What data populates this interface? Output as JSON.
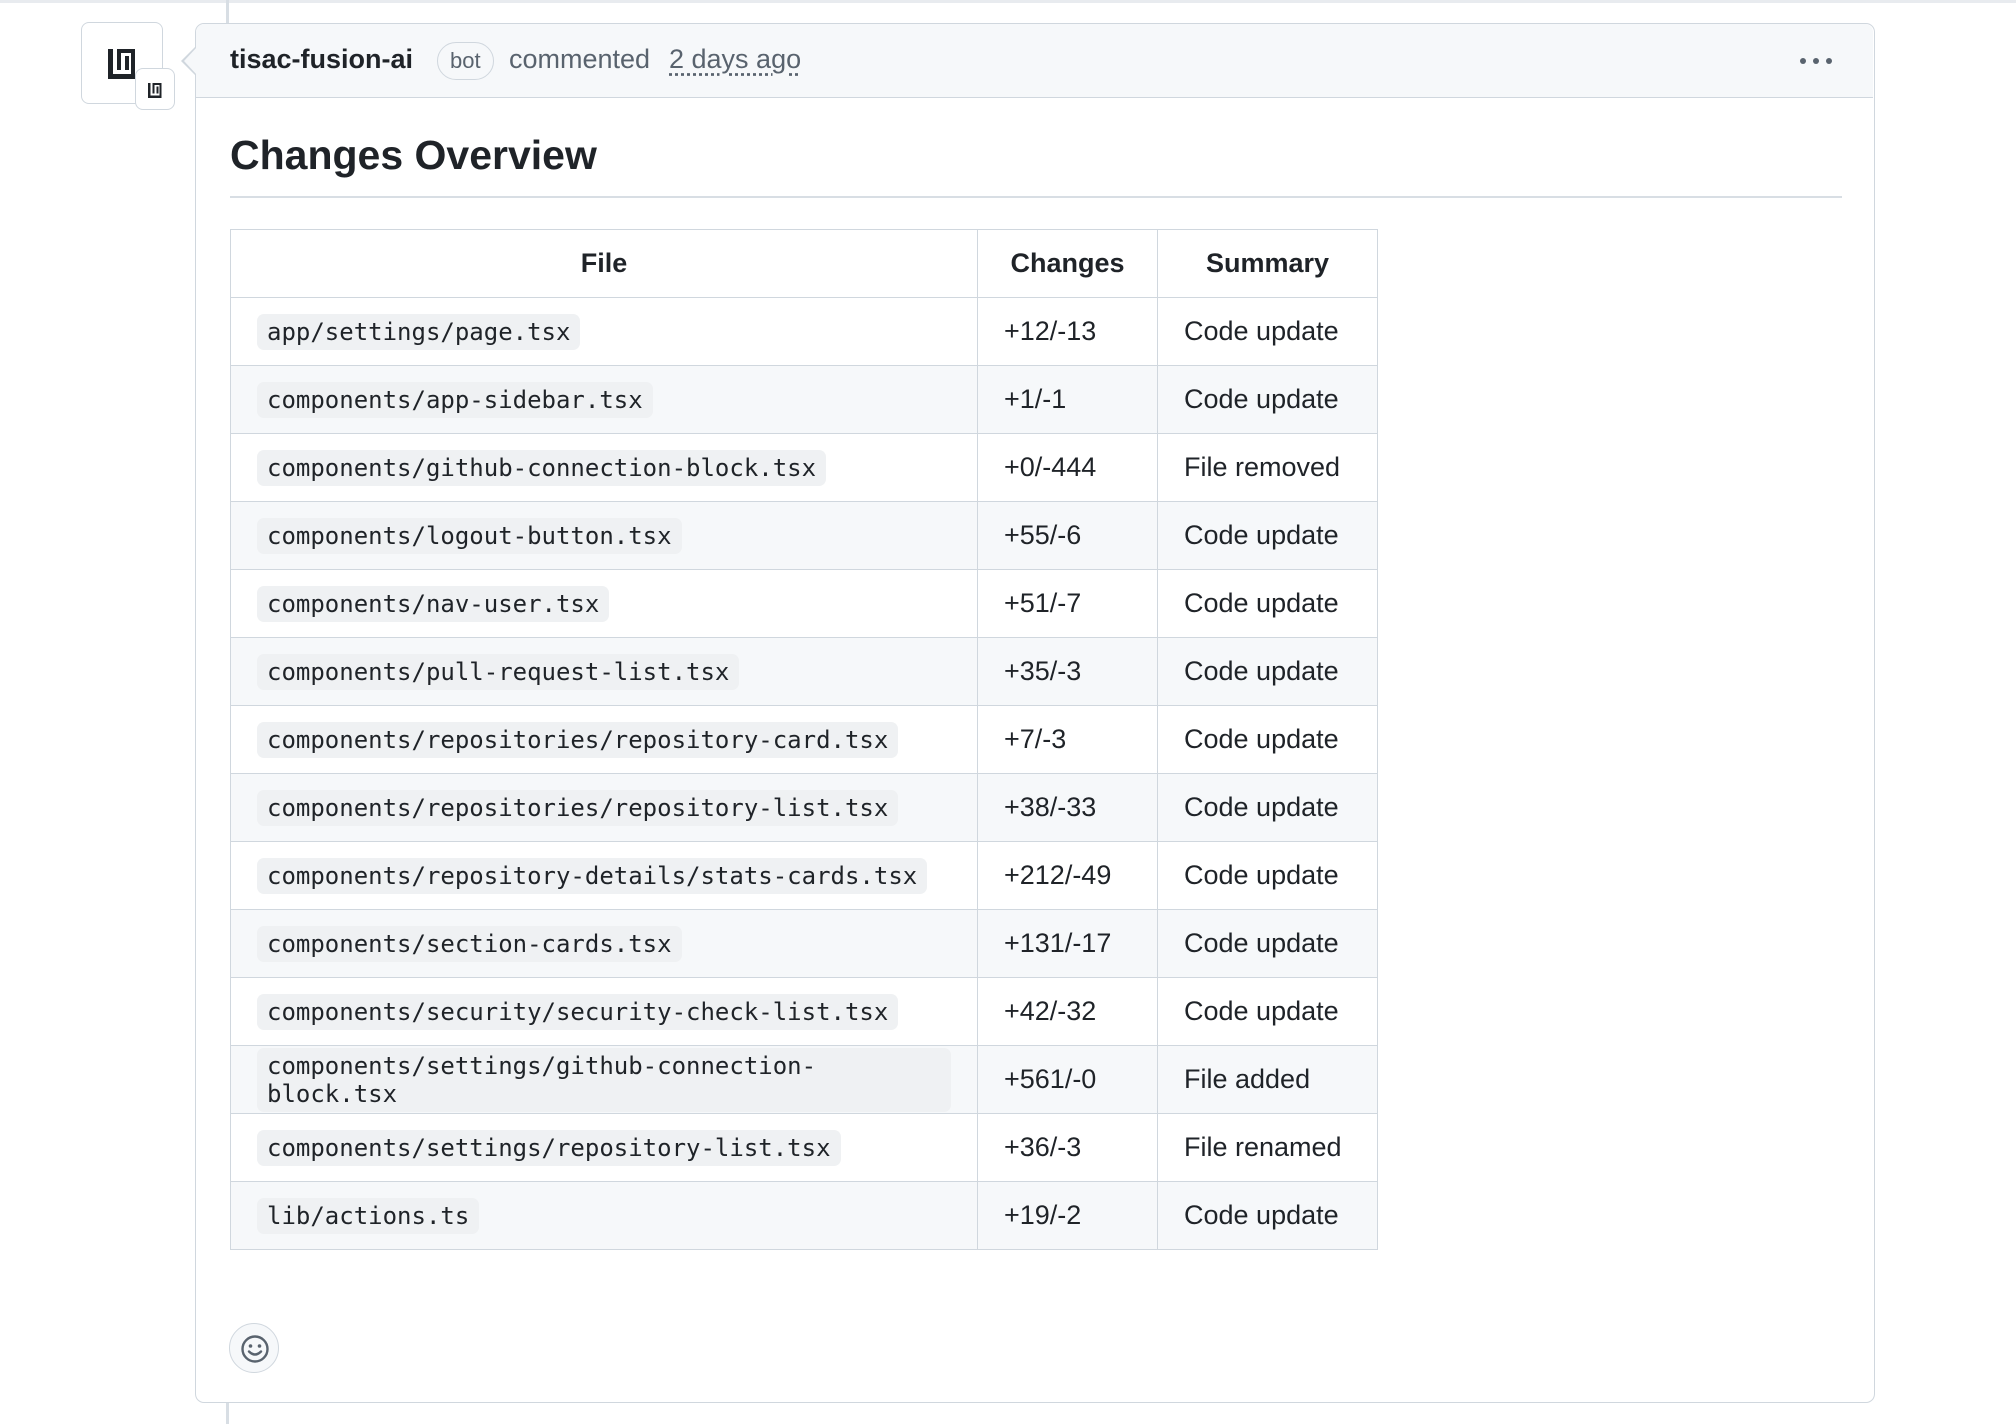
{
  "comment": {
    "author": "tisac-fusion-ai",
    "author_badge": "bot",
    "action": "commented",
    "time_ago": "2 days ago",
    "more_actions_icon": "kebab-horizontal-icon",
    "avatar_icon": "tisac-logo-icon"
  },
  "body": {
    "heading": "Changes Overview",
    "table": {
      "headers": {
        "file": "File",
        "changes": "Changes",
        "summary": "Summary"
      },
      "rows": [
        {
          "file": "app/settings/page.tsx",
          "changes": "+12/-13",
          "summary": "Code update"
        },
        {
          "file": "components/app-sidebar.tsx",
          "changes": "+1/-1",
          "summary": "Code update"
        },
        {
          "file": "components/github-connection-block.tsx",
          "changes": "+0/-444",
          "summary": "File removed"
        },
        {
          "file": "components/logout-button.tsx",
          "changes": "+55/-6",
          "summary": "Code update"
        },
        {
          "file": "components/nav-user.tsx",
          "changes": "+51/-7",
          "summary": "Code update"
        },
        {
          "file": "components/pull-request-list.tsx",
          "changes": "+35/-3",
          "summary": "Code update"
        },
        {
          "file": "components/repositories/repository-card.tsx",
          "changes": "+7/-3",
          "summary": "Code update"
        },
        {
          "file": "components/repositories/repository-list.tsx",
          "changes": "+38/-33",
          "summary": "Code update"
        },
        {
          "file": "components/repository-details/stats-cards.tsx",
          "changes": "+212/-49",
          "summary": "Code update"
        },
        {
          "file": "components/section-cards.tsx",
          "changes": "+131/-17",
          "summary": "Code update"
        },
        {
          "file": "components/security/security-check-list.tsx",
          "changes": "+42/-32",
          "summary": "Code update"
        },
        {
          "file": "components/settings/github-connection-block.tsx",
          "changes": "+561/-0",
          "summary": "File added"
        },
        {
          "file": "components/settings/repository-list.tsx",
          "changes": "+36/-3",
          "summary": "File renamed"
        },
        {
          "file": "lib/actions.ts",
          "changes": "+19/-2",
          "summary": "Code update"
        }
      ]
    }
  },
  "reactions": {
    "icon": "smiley-icon"
  }
}
